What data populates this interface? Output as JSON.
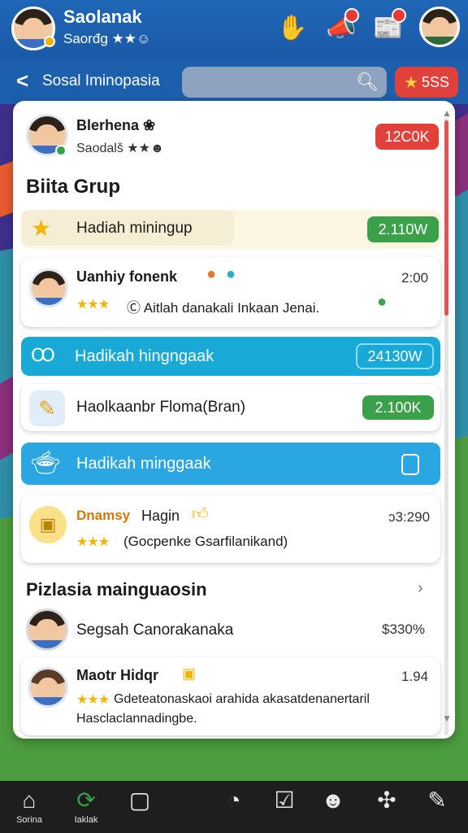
{
  "header": {
    "title": "Saolanak",
    "subtitle": "Saorđg ★★☺",
    "icons": [
      "hand-icon",
      "megaphone-icon",
      "calendar-icon"
    ]
  },
  "nav": {
    "back_title": "Sosal Iminopasia",
    "search_placeholder": "",
    "coins": "5SS"
  },
  "profile": {
    "name": "Blerhena ❀",
    "sub": "Saodalš ★★☻",
    "badge": "12C0K"
  },
  "section_title": "Biita Grup",
  "items": [
    {
      "label": "Hadiah miningup",
      "value": "2.110W"
    },
    {
      "name": "Uanhiy fonenk",
      "time": "2:00",
      "desc": "Ⓒ Aitlah danakali Inkaan Jenai."
    },
    {
      "label": "Hadikah hingngaak",
      "icon": "Ꝏ",
      "value": "24130W"
    },
    {
      "label": "Haolkaanbr Floma(Bran)",
      "value": "2.100K"
    },
    {
      "label": "Hadikah minggaak"
    },
    {
      "name_prefix": "Dnamsy",
      "name": "Hagin",
      "time": "ɔ3:290",
      "desc": "(Gocpenke Gsarfilanikand)"
    }
  ],
  "section2_title": "Pizlasia mainguaosin",
  "list2": [
    {
      "name": "Segsah Canorakanaka",
      "value": "$330%"
    },
    {
      "name": "Maotr Hidqr",
      "time": "1.94",
      "desc": "Gdeteatonaskaoi arahida akasatdenanertaril Hasclaclannadingbe."
    }
  ],
  "bottom_nav": [
    {
      "icon": "home-icon",
      "label": "Sorina"
    },
    {
      "icon": "refresh-icon",
      "label": "Iaklak"
    },
    {
      "icon": "square-icon",
      "label": ""
    },
    {
      "icon": "check-circle-icon",
      "label": ""
    },
    {
      "icon": "tasks-icon",
      "label": ""
    },
    {
      "icon": "chat-icon",
      "label": ""
    },
    {
      "icon": "puzzle-icon",
      "label": ""
    },
    {
      "icon": "edit-icon",
      "label": ""
    }
  ],
  "colors": {
    "accent_blue": "#1b5fad",
    "teal": "#18a9d6",
    "green": "#3aa14a",
    "red": "#e0413a"
  }
}
